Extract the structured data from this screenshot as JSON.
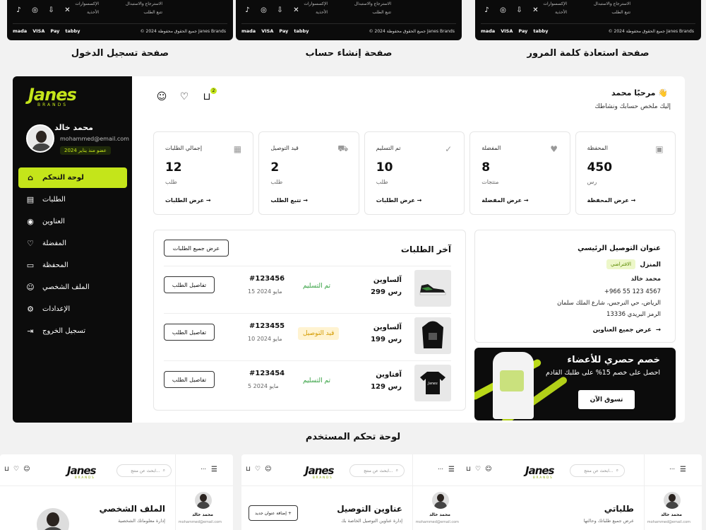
{
  "top_strip": {
    "cards": [
      {
        "col_a": [
          "الإكسسوارات",
          "الأحذية"
        ],
        "col_b": [
          "الاسترجاع والاستبدال",
          "تتبع الطلب"
        ],
        "copyright": "© 2024 جميع الحقوق محفوظة Janes Brands",
        "caption": "صفحة تسجيل الدخول"
      },
      {
        "col_a": [
          "الإكسسوارات",
          "الأحذية"
        ],
        "col_b": [
          "الاسترجاع والاستبدال",
          "تتبع الطلب"
        ],
        "copyright": "© 2024 جميع الحقوق محفوظة Janes Brands",
        "caption": "صفحة إنشاء حساب"
      },
      {
        "col_a": [
          "الإكسسوارات",
          "الأحذية"
        ],
        "col_b": [
          "الاسترجاع والاستبدال",
          "تتبع الطلب"
        ],
        "copyright": "© 2024 جميع الحقوق محفوظة Janes Brands",
        "caption": "صفحة استعادة كلمة المرور"
      }
    ],
    "social": [
      "♪",
      "◎",
      "⇩",
      "✕"
    ],
    "payments": [
      "mada",
      "VISA",
      "Pay",
      "tabby"
    ]
  },
  "brand": {
    "name": "Janes",
    "sub": "BRANDS"
  },
  "user": {
    "name": "محمد خالد",
    "email": "mohammed@email.com",
    "since": "عضو منذ يناير 2024"
  },
  "nav": [
    {
      "label": "لوحة التحكم",
      "icon": "home-icon",
      "glyph": "⌂",
      "active": true
    },
    {
      "label": "الطلبات",
      "icon": "clipboard-icon",
      "glyph": "▤",
      "active": false
    },
    {
      "label": "العناوين",
      "icon": "location-pin-icon",
      "glyph": "◉",
      "active": false
    },
    {
      "label": "المفضلة",
      "icon": "heart-icon",
      "glyph": "♡",
      "active": false
    },
    {
      "label": "المحفظة",
      "icon": "wallet-icon",
      "glyph": "▭",
      "active": false
    },
    {
      "label": "الملف الشخصي",
      "icon": "user-icon",
      "glyph": "☺",
      "active": false
    },
    {
      "label": "الإعدادات",
      "icon": "gear-icon",
      "glyph": "⚙",
      "active": false
    },
    {
      "label": "تسجيل الخروج",
      "icon": "logout-icon",
      "glyph": "⇥",
      "active": false
    }
  ],
  "header": {
    "cart_count": "2",
    "welcome": "مرحبًا محمد 👋",
    "subtitle": "إليك ملخص حسابك ونشاطك"
  },
  "stats": [
    {
      "label": "المحفظة",
      "value": "450",
      "unit": "رس",
      "link": "عرض المحفظة",
      "icon": "wallet-icon",
      "glyph": "▣"
    },
    {
      "label": "المفضلة",
      "value": "8",
      "unit": "منتجات",
      "link": "عرض المفضلة",
      "icon": "heart-icon",
      "glyph": "♥"
    },
    {
      "label": "تم التسليم",
      "value": "10",
      "unit": "طلب",
      "link": "عرض الطلبات",
      "icon": "delivered-icon",
      "glyph": "✓"
    },
    {
      "label": "قيد التوصيل",
      "value": "2",
      "unit": "طلب",
      "link": "تتبع الطلب",
      "icon": "truck-icon",
      "glyph": "⛟"
    },
    {
      "label": "إجمالي الطلبات",
      "value": "12",
      "unit": "طلب",
      "link": "عرض الطلبات",
      "icon": "box-icon",
      "glyph": "▦"
    }
  ],
  "orders": {
    "title": "آخر الطلبات",
    "view_all": "عرض جميع الطلبات",
    "details_label": "تفاصيل الطلب",
    "rows": [
      {
        "product": "آلساوين",
        "price": "299 رس",
        "status": "تم التسليم",
        "status_type": "done",
        "id": "#123456",
        "date": "15 مايو 2024",
        "thumb": "sneaker"
      },
      {
        "product": "آلساوين",
        "price": "199 رس",
        "status": "قيد التوصيل",
        "status_type": "ship",
        "id": "#123455",
        "date": "10 مايو 2024",
        "thumb": "hoodie"
      },
      {
        "product": "آفتاوين",
        "price": "129 رس",
        "status": "تم التسليم",
        "status_type": "done",
        "id": "#123454",
        "date": "5 مايو 2024",
        "thumb": "tshirt"
      }
    ]
  },
  "address": {
    "title": "عنوان التوصيل الرئيسي",
    "label": "المنزل",
    "default_badge": "الافتراضي",
    "name": "محمد خالد",
    "phone": "+966 55 123 4567",
    "street": "الرياض، حي النرجس، شارع الملك سلمان",
    "postal": "الرمز البريدي 13336",
    "view_all": "عرض جميع العناوين"
  },
  "promo": {
    "heading": "خصم حصري للأعضاء",
    "text": "احصل على خصم 15% على طلبك القادم",
    "cta": "تسوق الآن"
  },
  "caption_mid": "لوحة تحكم المستخدم",
  "bottom": [
    {
      "search": "ابحث عن منتج...",
      "title": "الملف الشخصي",
      "sub": "إدارة معلوماتك الشخصية",
      "user": "محمد خالد"
    },
    {
      "search": "ابحث عن منتج...",
      "title": "عناوين التوصيل",
      "sub": "إدارة عناوين التوصيل الخاصة بك",
      "user": "محمد خالد",
      "add": "إضافة عنوان جديد"
    },
    {
      "search": "ابحث عن منتج...",
      "title": "طلباتي",
      "sub": "عرض جميع طلباتك وحالتها",
      "user": "محمد خالد"
    }
  ]
}
